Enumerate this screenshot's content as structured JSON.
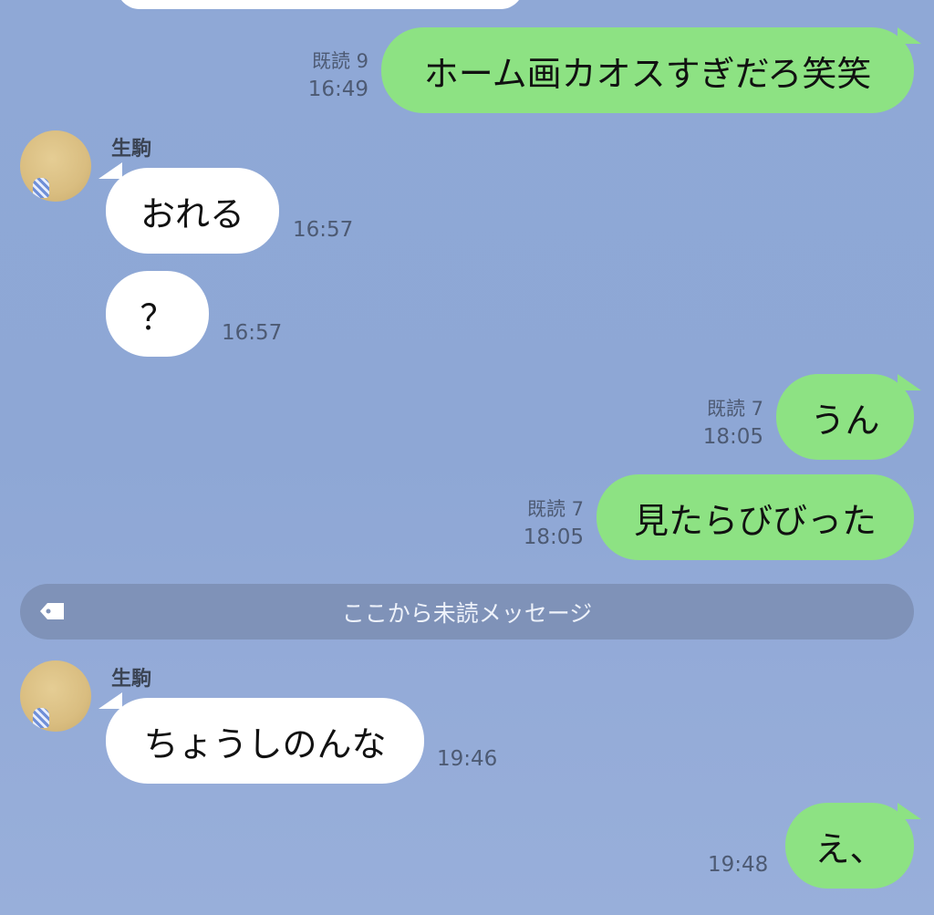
{
  "messages": [
    {
      "id": "m0",
      "text": ""
    },
    {
      "id": "m1",
      "text": "ホーム画カオスすぎだろ笑笑",
      "read": "既読 9",
      "time": "16:49"
    },
    {
      "id": "m2",
      "sender": "生駒",
      "text": "おれる",
      "time": "16:57"
    },
    {
      "id": "m3",
      "text": "？",
      "time": "16:57"
    },
    {
      "id": "m4",
      "text": "うん",
      "read": "既読 7",
      "time": "18:05"
    },
    {
      "id": "m5",
      "text": "見たらびびった",
      "read": "既読 7",
      "time": "18:05"
    },
    {
      "id": "m6",
      "sender": "生駒",
      "text": "ちょうしのんな",
      "time": "19:46"
    },
    {
      "id": "m7",
      "text": "え、",
      "time": "19:48"
    }
  ],
  "unread_divider": {
    "label": "ここから未読メッセージ",
    "icon": "tag-icon"
  },
  "colors": {
    "outgoing": "#8de283",
    "incoming": "#ffffff",
    "background": "#8fa8d6",
    "divider": "#7f92b8"
  }
}
